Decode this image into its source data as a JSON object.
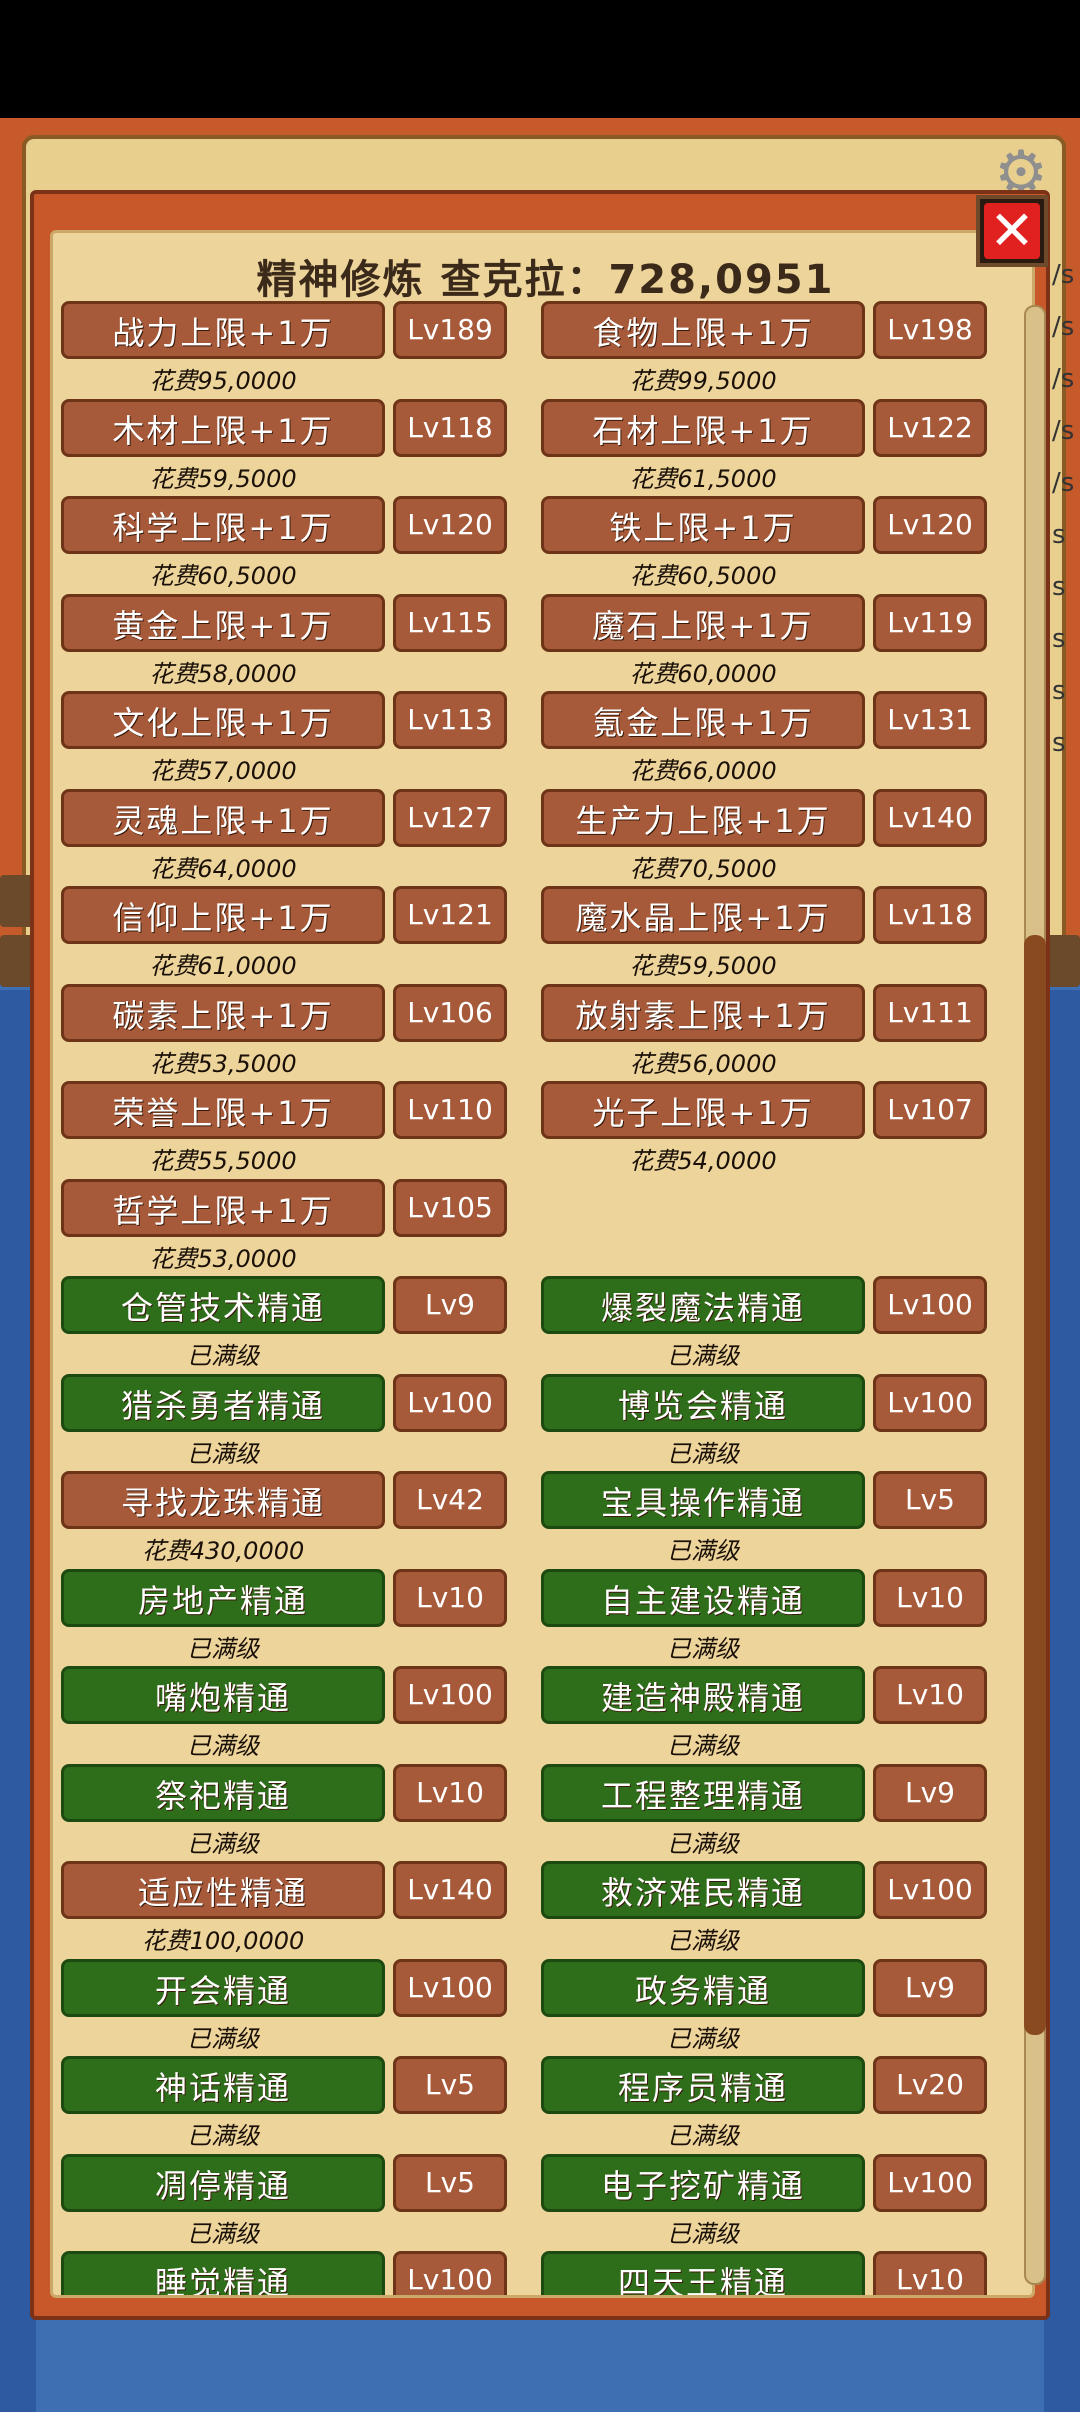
{
  "title": "精神修炼 查克拉：728,0951",
  "close_icon": "close-icon",
  "settings_icon": "gear-icon",
  "side_fragments": [
    "/s",
    "/s",
    "/s",
    "/s",
    "/s",
    "s",
    "s",
    "s",
    "s",
    "s"
  ],
  "items": [
    {
      "name": "战力上限+1万",
      "level": "Lv189",
      "status": "花费95,0000",
      "style": "brown"
    },
    {
      "name": "食物上限+1万",
      "level": "Lv198",
      "status": "花费99,5000",
      "style": "brown"
    },
    {
      "name": "木材上限+1万",
      "level": "Lv118",
      "status": "花费59,5000",
      "style": "brown"
    },
    {
      "name": "石材上限+1万",
      "level": "Lv122",
      "status": "花费61,5000",
      "style": "brown"
    },
    {
      "name": "科学上限+1万",
      "level": "Lv120",
      "status": "花费60,5000",
      "style": "brown"
    },
    {
      "name": "铁上限+1万",
      "level": "Lv120",
      "status": "花费60,5000",
      "style": "brown"
    },
    {
      "name": "黄金上限+1万",
      "level": "Lv115",
      "status": "花费58,0000",
      "style": "brown"
    },
    {
      "name": "魔石上限+1万",
      "level": "Lv119",
      "status": "花费60,0000",
      "style": "brown"
    },
    {
      "name": "文化上限+1万",
      "level": "Lv113",
      "status": "花费57,0000",
      "style": "brown"
    },
    {
      "name": "氪金上限+1万",
      "level": "Lv131",
      "status": "花费66,0000",
      "style": "brown"
    },
    {
      "name": "灵魂上限+1万",
      "level": "Lv127",
      "status": "花费64,0000",
      "style": "brown"
    },
    {
      "name": "生产力上限+1万",
      "level": "Lv140",
      "status": "花费70,5000",
      "style": "brown"
    },
    {
      "name": "信仰上限+1万",
      "level": "Lv121",
      "status": "花费61,0000",
      "style": "brown"
    },
    {
      "name": "魔水晶上限+1万",
      "level": "Lv118",
      "status": "花费59,5000",
      "style": "brown"
    },
    {
      "name": "碳素上限+1万",
      "level": "Lv106",
      "status": "花费53,5000",
      "style": "brown"
    },
    {
      "name": "放射素上限+1万",
      "level": "Lv111",
      "status": "花费56,0000",
      "style": "brown"
    },
    {
      "name": "荣誉上限+1万",
      "level": "Lv110",
      "status": "花费55,5000",
      "style": "brown"
    },
    {
      "name": "光子上限+1万",
      "level": "Lv107",
      "status": "花费54,0000",
      "style": "brown"
    },
    {
      "name": "哲学上限+1万",
      "level": "Lv105",
      "status": "花费53,0000",
      "style": "brown"
    },
    {
      "name": "仓管技术精通",
      "level": "Lv9",
      "status": "已满级",
      "style": "green"
    },
    {
      "name": "爆裂魔法精通",
      "level": "Lv100",
      "status": "已满级",
      "style": "green"
    },
    {
      "name": "猎杀勇者精通",
      "level": "Lv100",
      "status": "已满级",
      "style": "green"
    },
    {
      "name": "博览会精通",
      "level": "Lv100",
      "status": "已满级",
      "style": "green"
    },
    {
      "name": "寻找龙珠精通",
      "level": "Lv42",
      "status": "花费430,0000",
      "style": "brown"
    },
    {
      "name": "宝具操作精通",
      "level": "Lv5",
      "status": "已满级",
      "style": "green"
    },
    {
      "name": "房地产精通",
      "level": "Lv10",
      "status": "已满级",
      "style": "green"
    },
    {
      "name": "自主建设精通",
      "level": "Lv10",
      "status": "已满级",
      "style": "green"
    },
    {
      "name": "嘴炮精通",
      "level": "Lv100",
      "status": "已满级",
      "style": "green"
    },
    {
      "name": "建造神殿精通",
      "level": "Lv10",
      "status": "已满级",
      "style": "green"
    },
    {
      "name": "祭祀精通",
      "level": "Lv10",
      "status": "已满级",
      "style": "green"
    },
    {
      "name": "工程整理精通",
      "level": "Lv9",
      "status": "已满级",
      "style": "green"
    },
    {
      "name": "适应性精通",
      "level": "Lv140",
      "status": "花费100,0000",
      "style": "brown"
    },
    {
      "name": "救济难民精通",
      "level": "Lv100",
      "status": "已满级",
      "style": "green"
    },
    {
      "name": "开会精通",
      "level": "Lv100",
      "status": "已满级",
      "style": "green"
    },
    {
      "name": "政务精通",
      "level": "Lv9",
      "status": "已满级",
      "style": "green"
    },
    {
      "name": "神话精通",
      "level": "Lv5",
      "status": "已满级",
      "style": "green"
    },
    {
      "name": "程序员精通",
      "level": "Lv20",
      "status": "已满级",
      "style": "green"
    },
    {
      "name": "凋停精通",
      "level": "Lv5",
      "status": "已满级",
      "style": "green"
    },
    {
      "name": "电子挖矿精通",
      "level": "Lv100",
      "status": "已满级",
      "style": "green"
    },
    {
      "name": "睡觉精通",
      "level": "Lv100",
      "status": "",
      "style": "green"
    },
    {
      "name": "四天王精通",
      "level": "Lv10",
      "status": "",
      "style": "green"
    }
  ]
}
